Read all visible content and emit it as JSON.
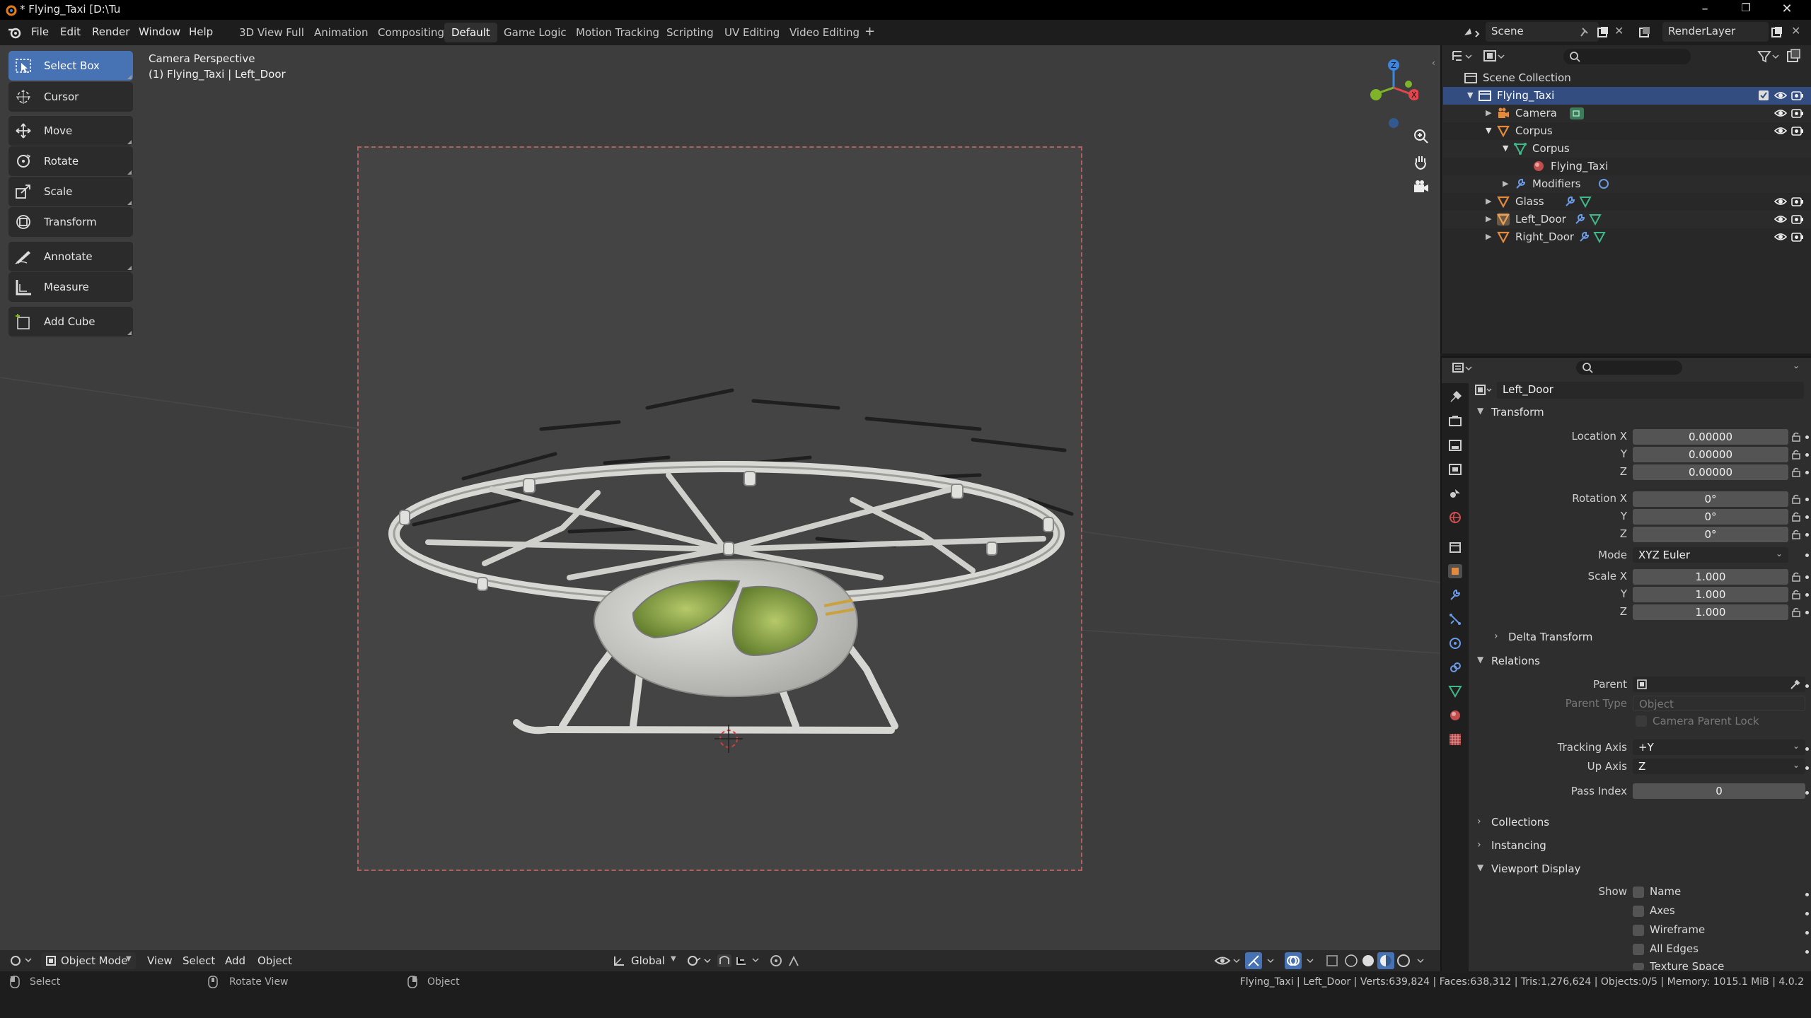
{
  "window": {
    "title": "* Flying_Taxi [D:\\Tu"
  },
  "menu": [
    "File",
    "Edit",
    "Render",
    "Window",
    "Help"
  ],
  "workspaces": {
    "tabs": [
      "3D View Full",
      "Animation",
      "Compositing",
      "Default",
      "Game Logic",
      "Motion Tracking",
      "Scripting",
      "UV Editing",
      "Video Editing"
    ],
    "active": "Default",
    "add": "+"
  },
  "scene": {
    "label": "Scene",
    "render_layer": "RenderLayer"
  },
  "viewport": {
    "perspective": "Camera Perspective",
    "object_info": "(1) Flying_Taxi | Left_Door"
  },
  "toolbar": {
    "tools": [
      "Select Box",
      "Cursor",
      "Move",
      "Rotate",
      "Scale",
      "Transform",
      "Annotate",
      "Measure",
      "Add Cube"
    ],
    "active": "Select Box"
  },
  "vp_header": {
    "mode": "Object Mode",
    "menus": [
      "View",
      "Select",
      "Add",
      "Object"
    ],
    "orientation": "Global"
  },
  "status": {
    "select": "Select",
    "rotate": "Rotate View",
    "object": "Object",
    "stats": "Flying_Taxi | Left_Door | Verts:639,824 | Faces:638,312 | Tris:1,276,624 | Objects:0/5 | Memory: 1015.1 MiB | 4.0.2"
  },
  "outliner": {
    "root": "Scene Collection",
    "rows": [
      "Flying_Taxi",
      "Camera",
      "Corpus",
      "Corpus",
      "Flying_Taxi",
      "Modifiers",
      "Glass",
      "Left_Door",
      "Right_Door"
    ]
  },
  "properties": {
    "object_name": "Left_Door",
    "transform": {
      "title": "Transform",
      "location_label": "Location X",
      "rotation_label": "Rotation X",
      "scale_label": "Scale X",
      "y_label": "Y",
      "z_label": "Z",
      "location": [
        "0.00000",
        "0.00000",
        "0.00000"
      ],
      "rotation": [
        "0°",
        "0°",
        "0°"
      ],
      "mode_label": "Mode",
      "mode": "XYZ Euler",
      "scale": [
        "1.000",
        "1.000",
        "1.000"
      ]
    },
    "delta": "Delta Transform",
    "relations": {
      "title": "Relations",
      "parent_label": "Parent",
      "parent_type_label": "Parent Type",
      "parent_type": "Object",
      "camera_parent_lock": "Camera Parent Lock",
      "tracking_label": "Tracking Axis",
      "tracking": "+Y",
      "up_label": "Up Axis",
      "up": "Z",
      "pass_label": "Pass Index",
      "pass": "0"
    },
    "collections": "Collections",
    "instancing": "Instancing",
    "viewport_display": {
      "title": "Viewport Display",
      "show_label": "Show",
      "options": [
        "Name",
        "Axes",
        "Wireframe",
        "All Edges",
        "Texture Space"
      ]
    }
  },
  "colors": {
    "accent": "#4772b3",
    "selected_row": "#334d80",
    "x_axis": "#e0464b",
    "y_axis": "#7fb32a",
    "z_axis": "#3c86e0"
  }
}
